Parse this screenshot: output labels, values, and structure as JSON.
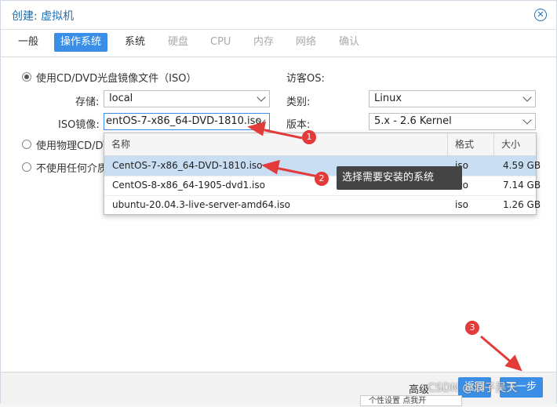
{
  "window": {
    "title": "创建: 虚拟机"
  },
  "tabs": [
    {
      "label": "一般",
      "state": "normal"
    },
    {
      "label": "操作系统",
      "state": "active"
    },
    {
      "label": "系统",
      "state": "normal"
    },
    {
      "label": "硬盘",
      "state": "disabled"
    },
    {
      "label": "CPU",
      "state": "disabled"
    },
    {
      "label": "内存",
      "state": "disabled"
    },
    {
      "label": "网络",
      "state": "disabled"
    },
    {
      "label": "确认",
      "state": "disabled"
    }
  ],
  "media": {
    "option_iso": "使用CD/DVD光盘镜像文件（ISO）",
    "option_physical": "使用物理CD/DV",
    "option_none": "不使用任何介质",
    "storage_label": "存储:",
    "storage_value": "local",
    "iso_label": "ISO镜像:",
    "iso_value": "entOS-7-x86_64-DVD-1810.iso"
  },
  "guest": {
    "heading": "访客OS:",
    "type_label": "类别:",
    "type_value": "Linux",
    "version_label": "版本:",
    "version_value": "5.x - 2.6 Kernel"
  },
  "iso_list": {
    "columns": [
      "名称",
      "格式",
      "大小"
    ],
    "rows": [
      {
        "name": "CentOS-7-x86_64-DVD-1810.iso",
        "format": "iso",
        "size": "4.59 GB",
        "selected": true
      },
      {
        "name": "CentOS-8-x86_64-1905-dvd1.iso",
        "format": "iso",
        "size": "7.14 GB",
        "selected": false
      },
      {
        "name": "ubuntu-20.04.3-live-server-amd64.iso",
        "format": "iso",
        "size": "1.26 GB",
        "selected": false
      }
    ]
  },
  "annotations": {
    "step1": "1",
    "step2": "2",
    "step3": "3",
    "tooltip": "选择需要安装的系统"
  },
  "footer": {
    "advanced_label": "高级",
    "back_label": "返回",
    "next_label": "下一步",
    "watermark": "CSDN @浪子吴天",
    "bottom_popup": "个性设置    点我开"
  },
  "colors": {
    "accent": "#3a8ee6",
    "annotation": "#e33a3a",
    "selected_row": "#c9def3"
  }
}
